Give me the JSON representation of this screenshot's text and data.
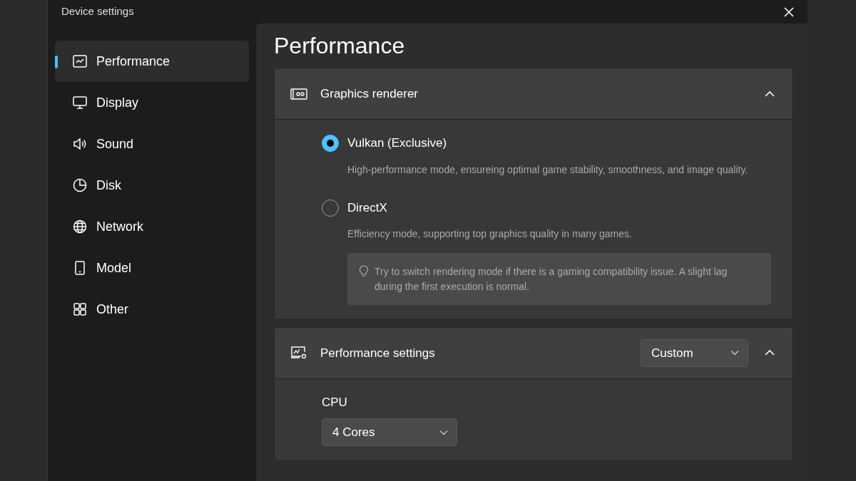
{
  "window": {
    "title": "Device settings"
  },
  "sidebar": {
    "items": [
      {
        "label": "Performance",
        "selected": true
      },
      {
        "label": "Display",
        "selected": false
      },
      {
        "label": "Sound",
        "selected": false
      },
      {
        "label": "Disk",
        "selected": false
      },
      {
        "label": "Network",
        "selected": false
      },
      {
        "label": "Model",
        "selected": false
      },
      {
        "label": "Other",
        "selected": false
      }
    ]
  },
  "page_title": "Performance",
  "graphics_renderer": {
    "title": "Graphics renderer",
    "expanded": true,
    "options": [
      {
        "label": "Vulkan (Exclusive)",
        "description": "High-performance mode, ensureing optimal game stability, smoothness, and image quality.",
        "selected": true
      },
      {
        "label": "DirectX",
        "description": "Efficiency mode, supporting top graphics quality in many games.",
        "selected": false
      }
    ],
    "tip": "Try to switch rendering mode if there is a gaming compatibility issue. A slight lag during the first execution is normal."
  },
  "performance_settings": {
    "title": "Performance settings",
    "expanded": true,
    "preset": "Custom",
    "cpu": {
      "label": "CPU",
      "value": "4 Cores"
    }
  }
}
